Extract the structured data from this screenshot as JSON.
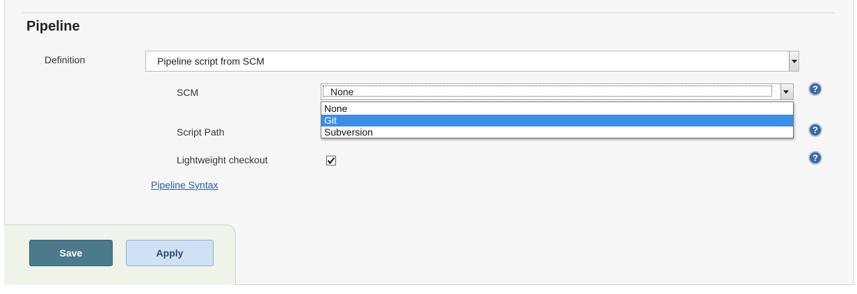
{
  "section": {
    "title": "Pipeline"
  },
  "definition": {
    "label": "Definition",
    "value": "Pipeline script from SCM"
  },
  "scm": {
    "label": "SCM",
    "value": "None",
    "options": [
      "None",
      "Git",
      "Subversion"
    ],
    "highlighted_option": "Git"
  },
  "script_path": {
    "label": "Script Path"
  },
  "lightweight_checkout": {
    "label": "Lightweight checkout",
    "checked": true
  },
  "links": {
    "pipeline_syntax": "Pipeline Syntax"
  },
  "buttons": {
    "save": "Save",
    "apply": "Apply"
  },
  "colors": {
    "highlight": "#3b8fe8",
    "save_button": "#4a7a8c",
    "apply_button": "#cfe2f5",
    "link": "#2a5aa9"
  },
  "icons": [
    "help-icon",
    "checkmark-icon",
    "chevron-down-icon"
  ]
}
